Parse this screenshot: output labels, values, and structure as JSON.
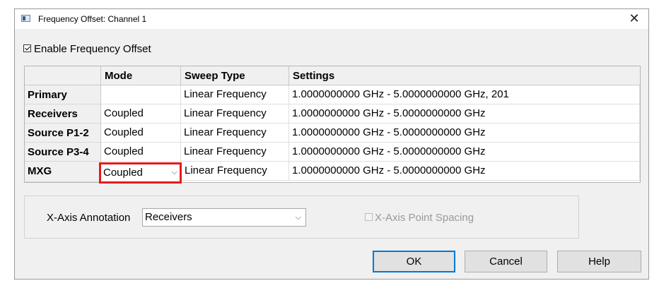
{
  "window": {
    "title": "Frequency Offset: Channel 1",
    "close_glyph": "✕"
  },
  "enable": {
    "label": "Enable Frequency Offset",
    "checked": true
  },
  "grid": {
    "columns": [
      "Mode",
      "Sweep Type",
      "Settings"
    ],
    "rows": [
      {
        "name": "Primary",
        "mode": "",
        "sweep_type": "Linear Frequency",
        "settings": "1.0000000000 GHz - 5.0000000000 GHz, 201"
      },
      {
        "name": "Receivers",
        "mode": "Coupled",
        "sweep_type": "Linear Frequency",
        "settings": "1.0000000000 GHz - 5.0000000000 GHz"
      },
      {
        "name": "Source P1-2",
        "mode": "Coupled",
        "sweep_type": "Linear Frequency",
        "settings": "1.0000000000 GHz - 5.0000000000 GHz"
      },
      {
        "name": "Source P3-4",
        "mode": "Coupled",
        "sweep_type": "Linear Frequency",
        "settings": "1.0000000000 GHz - 5.0000000000 GHz"
      },
      {
        "name": "MXG",
        "mode": "Coupled",
        "sweep_type": "Linear Frequency",
        "settings": "1.0000000000 GHz - 5.0000000000 GHz"
      }
    ],
    "highlight_color": "#e41b1b"
  },
  "annotation": {
    "label": "X-Axis Annotation",
    "selected": "Receivers",
    "point_spacing_label": "X-Axis Point Spacing",
    "point_spacing_enabled": false
  },
  "buttons": {
    "ok": "OK",
    "cancel": "Cancel",
    "help": "Help"
  },
  "icons": {
    "chevron": "⌵"
  }
}
